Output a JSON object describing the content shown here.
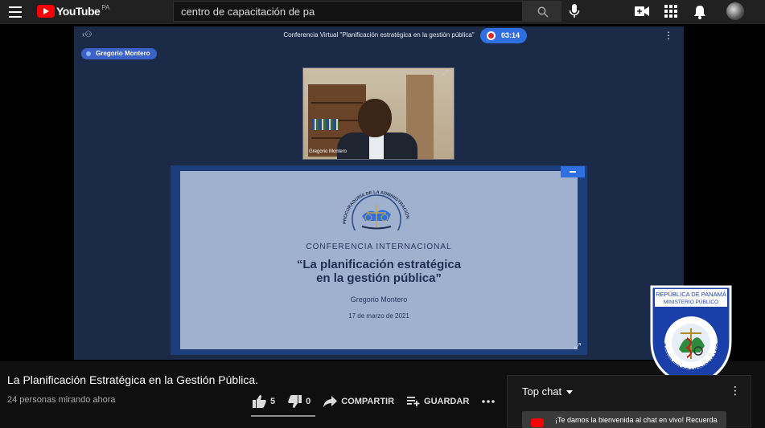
{
  "header": {
    "logo_text": "YouTube",
    "region": "PA",
    "search_value": "centro de capacitación de pa"
  },
  "icons": {
    "menu": "hamburger-menu-icon",
    "search": "search-icon",
    "mic": "microphone-icon",
    "create": "create-video-icon",
    "apps": "apps-grid-icon",
    "notifications": "bell-icon"
  },
  "meeting": {
    "title": "Conferencia Virtual \"Planificación estratégica en la gestión pública\"",
    "timer": "03:14",
    "speaker_tag": "Gregorio Montero",
    "camera_name": "Gregorio Montero"
  },
  "slide": {
    "kicker": "CONFERENCIA INTERNACIONAL",
    "title_line1": "“La planificación estratégica",
    "title_line2": "en la gestión pública”",
    "author": "Gregorio Montero",
    "date": "17 de marzo de 2021",
    "seal_text": "PROCURADURÍA DE LA ADMINISTRACIÓN"
  },
  "watermark": {
    "line1": "REPÚBLICA DE PANAMÁ",
    "line2": "MINISTERIO PÚBLICO",
    "ring_text": "INSTITUTO DE MEDICINA LEGAL Y CIENCIAS FORENSES"
  },
  "video": {
    "title": "La Planificación Estratégica en la Gestión Pública.",
    "viewers": "24 personas mirando ahora",
    "likes": "5",
    "dislikes": "0",
    "share_label": "COMPARTIR",
    "save_label": "GUARDAR",
    "like_ratio": 1.0
  },
  "chat": {
    "mode_label": "Top chat",
    "welcome_message": "¡Te damos la bienvenida al chat en vivo! Recuerda"
  },
  "colors": {
    "brand_red": "#ff0000",
    "meeting_accent": "#2f6fe0",
    "slide_bg": "#9fb1ce"
  }
}
